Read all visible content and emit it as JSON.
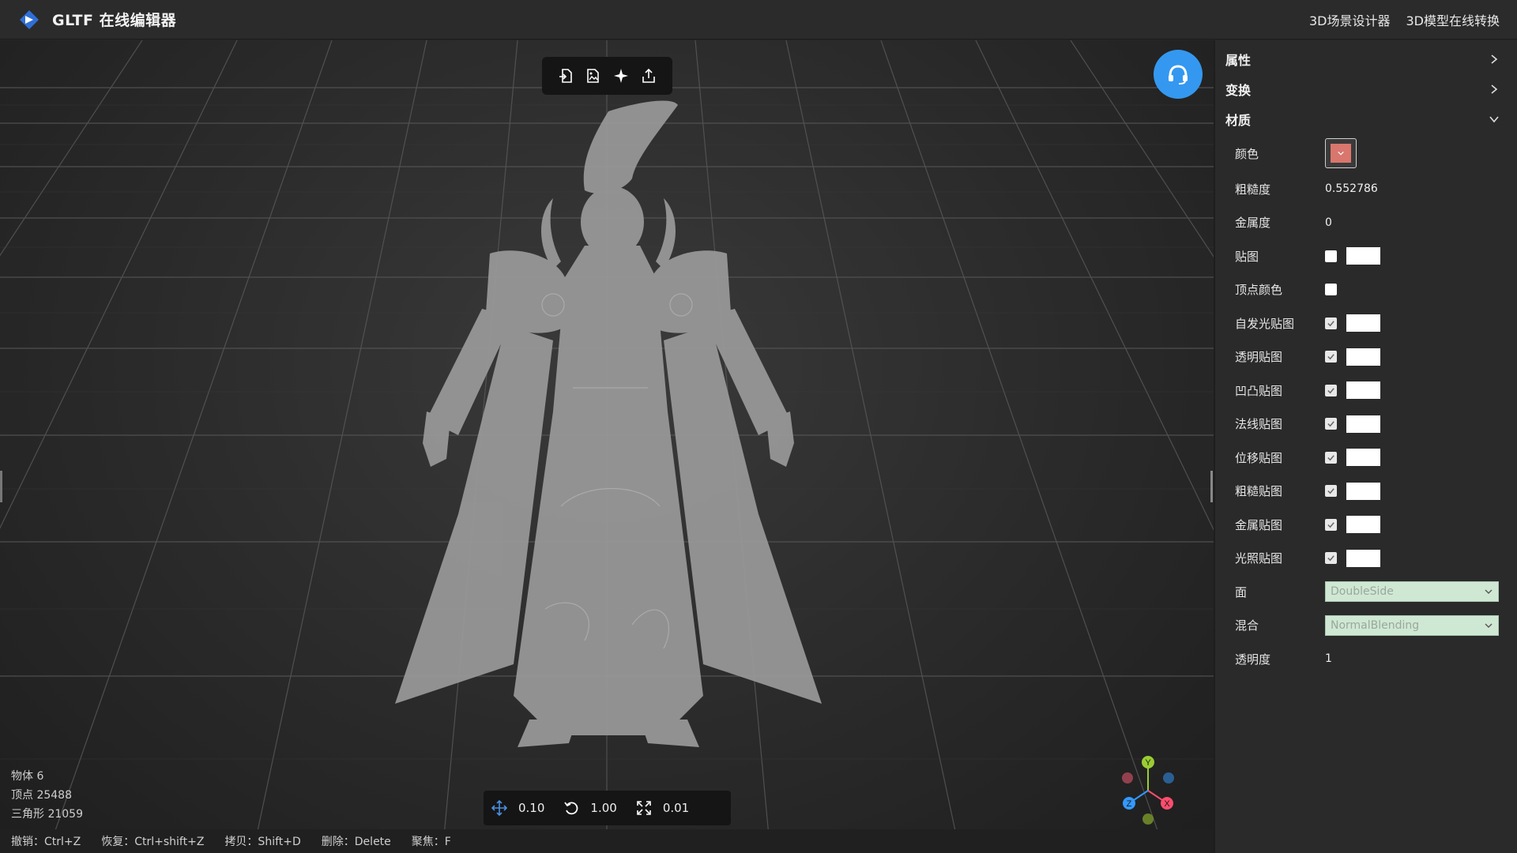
{
  "app": {
    "title": "GLTF 在线编辑器"
  },
  "header": {
    "links": [
      "3D场景设计器",
      "3D模型在线转换"
    ]
  },
  "viewport": {
    "stats": {
      "objects": "物体 6",
      "vertices": "顶点 25488",
      "triangles": "三角形 21059"
    },
    "bottom_toolbar": {
      "translate_step": "0.10",
      "rotate_step": "1.00",
      "scale_step": "0.01"
    },
    "shortcuts": [
      "撤销：Ctrl+Z",
      "恢复：Ctrl+shift+Z",
      "拷贝：Shift+D",
      "删除：Delete",
      "聚焦：F"
    ],
    "axes": {
      "x": "X",
      "y": "Y",
      "z": "Z"
    }
  },
  "panel": {
    "sections": {
      "properties": "属性",
      "transform": "变换",
      "material": "材质"
    },
    "material": {
      "color_label": "颜色",
      "color_value": "#d9766d",
      "roughness_label": "粗糙度",
      "roughness_value": "0.552786",
      "metalness_label": "金属度",
      "metalness_value": "0",
      "maps": [
        {
          "label": "贴图",
          "checked": false,
          "box": true
        },
        {
          "label": "顶点颜色",
          "checked": false,
          "box": false
        },
        {
          "label": "自发光贴图",
          "checked": true,
          "box": true
        },
        {
          "label": "透明贴图",
          "checked": true,
          "box": true
        },
        {
          "label": "凹凸贴图",
          "checked": true,
          "box": true
        },
        {
          "label": "法线贴图",
          "checked": true,
          "box": true
        },
        {
          "label": "位移贴图",
          "checked": true,
          "box": true
        },
        {
          "label": "粗糙贴图",
          "checked": true,
          "box": true
        },
        {
          "label": "金属贴图",
          "checked": true,
          "box": true
        },
        {
          "label": "光照贴图",
          "checked": true,
          "box": true
        }
      ],
      "side_label": "面",
      "side_value": "DoubleSide",
      "blending_label": "混合",
      "blending_value": "NormalBlending",
      "opacity_label": "透明度",
      "opacity_value": "1"
    }
  }
}
